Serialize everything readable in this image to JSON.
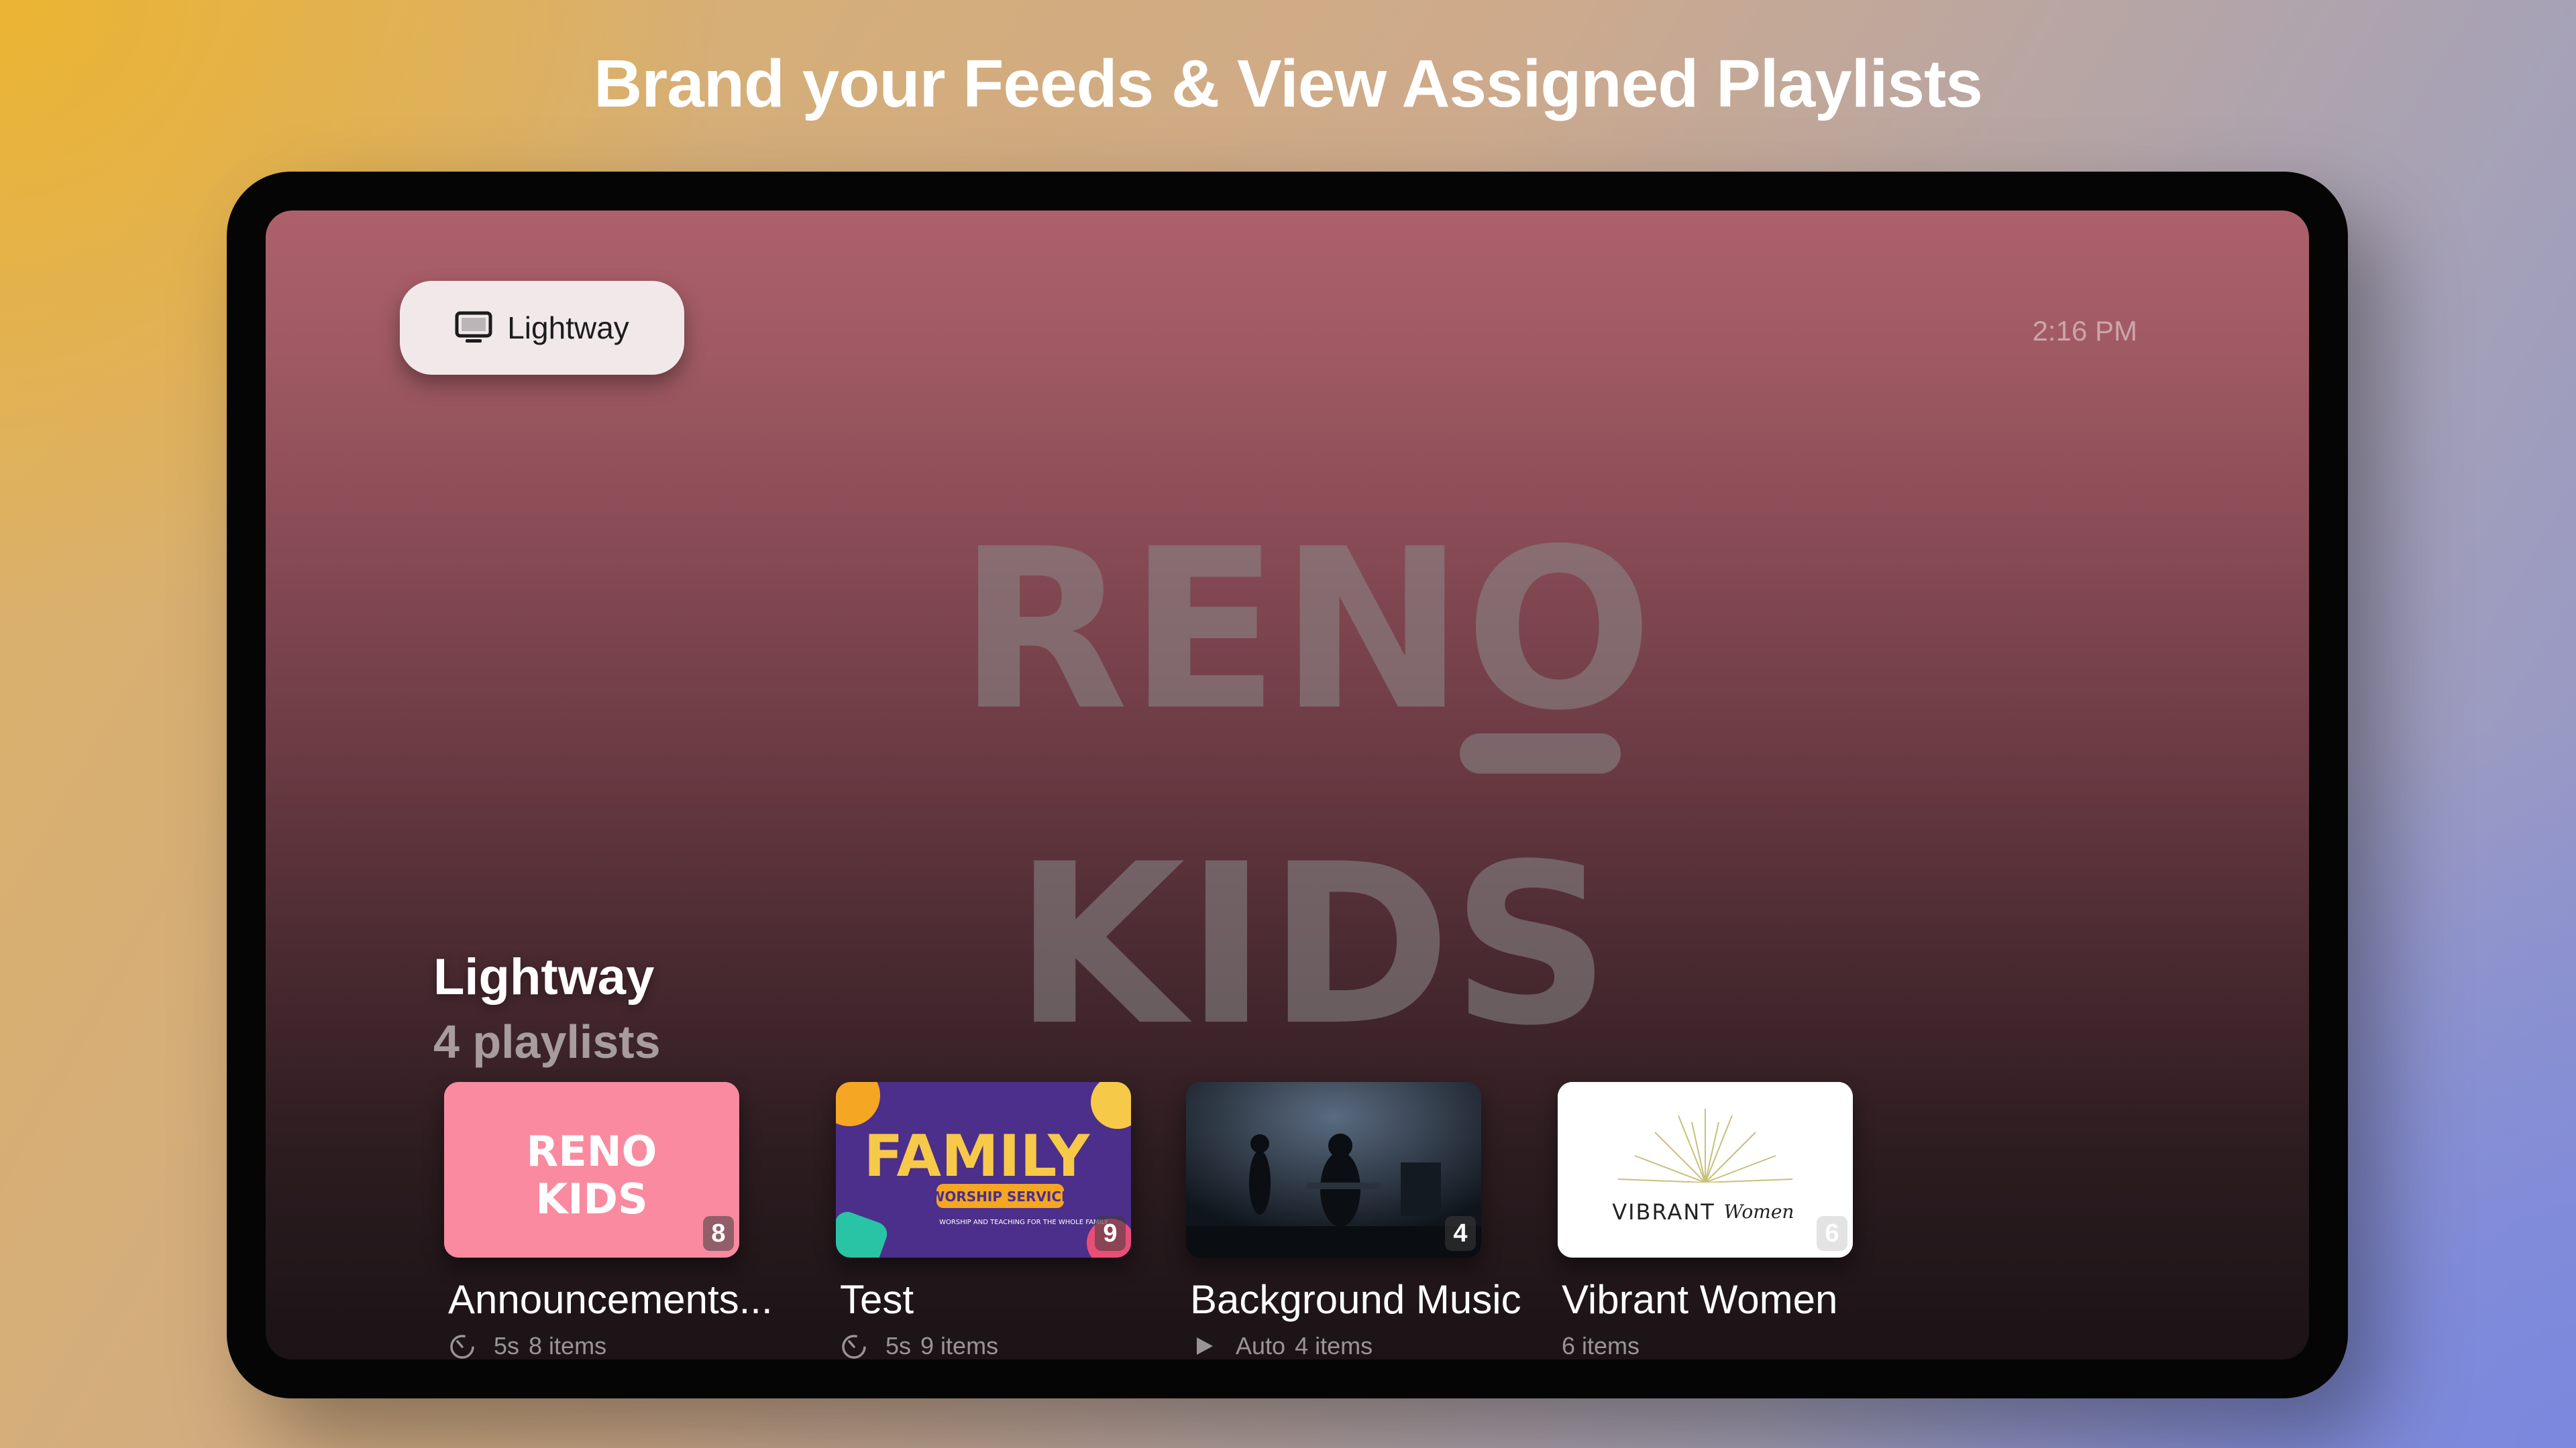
{
  "headline": "Brand your Feeds & View Assigned Playlists",
  "source": {
    "label": "Lightway",
    "icon": "tv-icon"
  },
  "clock": "2:16 PM",
  "background_logo": {
    "line1": "RENO",
    "line2": "KIDS",
    "color": "#8a8a8a"
  },
  "section": {
    "title": "Lightway",
    "subtitle": "4 playlists"
  },
  "playlists": [
    {
      "title": "Announcements...",
      "count": "8",
      "mode": "5s",
      "mode_icon": "timer-icon",
      "items": "8 items",
      "thumb_text1": "RENO",
      "thumb_text2": "KIDS",
      "thumb_color": "#f98aa0"
    },
    {
      "title": "Test",
      "count": "9",
      "mode": "5s",
      "mode_icon": "timer-icon",
      "items": "9 items",
      "thumb_text1": "FAMILY",
      "thumb_text2": "WORSHIP SERVICE",
      "thumb_text3": "WORSHIP AND TEACHING FOR THE WHOLE FAMILY",
      "thumb_color": "#4b2f8a"
    },
    {
      "title": "Background Music",
      "count": "4",
      "mode": "Auto",
      "mode_icon": "play-icon",
      "items": "4 items",
      "thumb_color": "#1d2530"
    },
    {
      "title": "Vibrant Women",
      "count": "6",
      "items": "6 items",
      "thumb_text1": "VIBRANT",
      "thumb_text2": "Women",
      "thumb_color": "#ffffff"
    }
  ]
}
